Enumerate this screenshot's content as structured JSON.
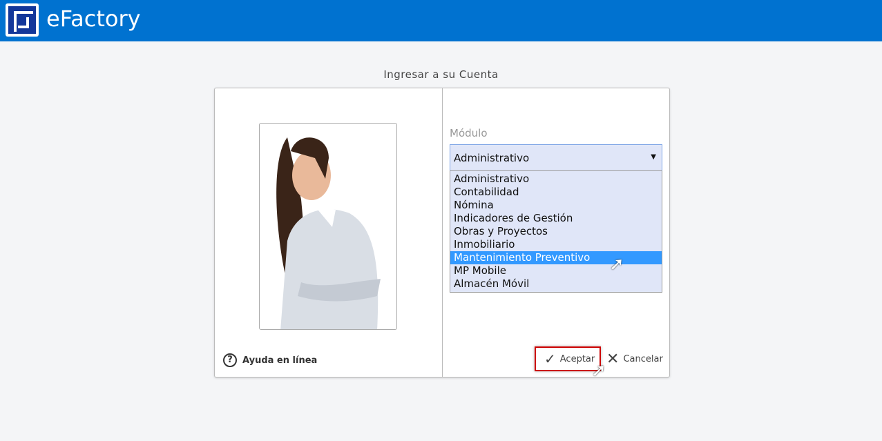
{
  "header": {
    "brand": "eFactory",
    "logo_icon": "efactory-logo"
  },
  "page": {
    "title": "Ingresar a su Cuenta"
  },
  "left": {
    "help_label": "Ayuda en línea"
  },
  "module": {
    "label": "Módulo",
    "selected": "Administrativo",
    "options": [
      "Administrativo",
      "Contabilidad",
      "Nómina",
      "Indicadores de Gestión",
      "Obras y Proyectos",
      "Inmobiliario",
      "Mantenimiento Preventivo",
      "MP Mobile",
      "Almacén Móvil"
    ],
    "highlighted": "Mantenimiento Preventivo"
  },
  "actions": {
    "accept": "Aceptar",
    "cancel": "Cancelar"
  },
  "colors": {
    "header": "#0072d0",
    "highlight": "#3399ff",
    "dropdown_bg": "#e0e6f8",
    "accept_border": "#cc0000"
  }
}
